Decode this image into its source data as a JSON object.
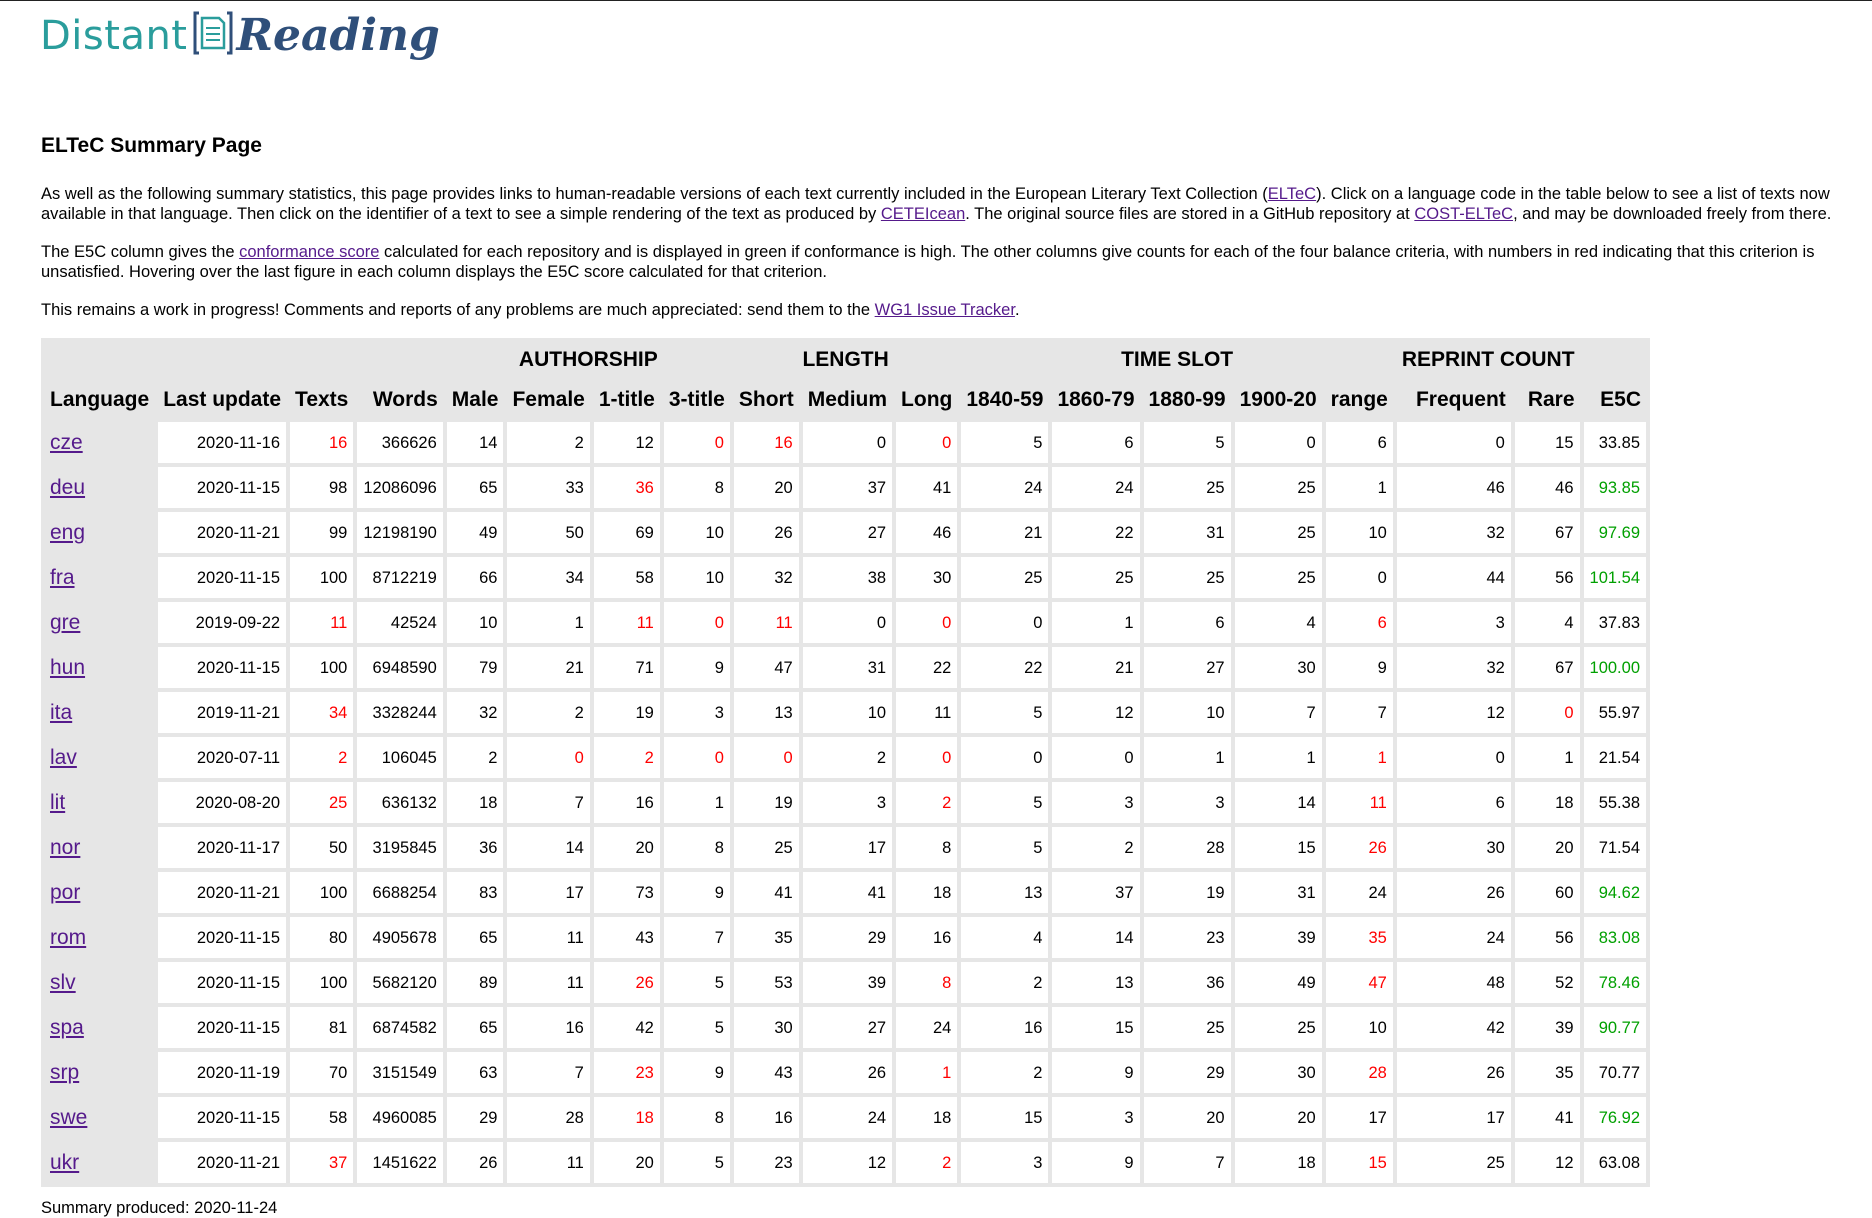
{
  "logo": {
    "word1": "Distant",
    "word2": "Reading"
  },
  "page_title": "ELTeC Summary Page",
  "intro": {
    "p1_a": "As well as the following summary statistics, this page provides links to human-readable versions of each text currently included in the European Literary Text Collection (",
    "p1_link1": "ELTeC",
    "p1_b": "). Click on a language code in the table below to see a list of texts now available in that language. Then click on the identifier of a text to see a simple rendering of the text as produced by ",
    "p1_link2": "CETEIcean",
    "p1_c": ". The original source files are stored in a GitHub repository at ",
    "p1_link3": "COST-ELTeC",
    "p1_d": ", and may be downloaded freely from there.",
    "p2_a": "The E5C column gives the ",
    "p2_link": "conformance score",
    "p2_b": " calculated for each repository and is displayed in green if conformance is high. The other columns give counts for each of the four balance criteria, with numbers in red indicating that this criterion is unsatisfied. Hovering over the last figure in each column displays the E5C score calculated for that criterion.",
    "p3_a": "This remains a work in progress! Comments and reports of any problems are much appreciated: send them to the ",
    "p3_link": "WG1 Issue Tracker",
    "p3_b": "."
  },
  "table": {
    "groups": [
      "AUTHORSHIP",
      "LENGTH",
      "TIME SLOT",
      "REPRINT COUNT"
    ],
    "headers": [
      "Language",
      "Last update",
      "Texts",
      "Words",
      "Male",
      "Female",
      "1-title",
      "3-title",
      "Short",
      "Medium",
      "Long",
      "1840-59",
      "1860-79",
      "1880-99",
      "1900-20",
      "range",
      "Frequent",
      "Rare",
      "E5C"
    ],
    "rows": [
      {
        "lang": "cze",
        "cells": [
          "2020-11-16",
          "16",
          "366626",
          "14",
          "2",
          "12",
          "0",
          "16",
          "0",
          "0",
          "5",
          "6",
          "5",
          "0",
          "6",
          "0",
          "15",
          "33.85"
        ],
        "red": [
          1,
          6,
          7,
          9
        ],
        "green": false
      },
      {
        "lang": "deu",
        "cells": [
          "2020-11-15",
          "98",
          "12086096",
          "65",
          "33",
          "36",
          "8",
          "20",
          "37",
          "41",
          "24",
          "24",
          "25",
          "25",
          "1",
          "46",
          "46",
          "93.85"
        ],
        "red": [
          5
        ],
        "green": true
      },
      {
        "lang": "eng",
        "cells": [
          "2020-11-21",
          "99",
          "12198190",
          "49",
          "50",
          "69",
          "10",
          "26",
          "27",
          "46",
          "21",
          "22",
          "31",
          "25",
          "10",
          "32",
          "67",
          "97.69"
        ],
        "red": [],
        "green": true
      },
      {
        "lang": "fra",
        "cells": [
          "2020-11-15",
          "100",
          "8712219",
          "66",
          "34",
          "58",
          "10",
          "32",
          "38",
          "30",
          "25",
          "25",
          "25",
          "25",
          "0",
          "44",
          "56",
          "101.54"
        ],
        "red": [],
        "green": true
      },
      {
        "lang": "gre",
        "cells": [
          "2019-09-22",
          "11",
          "42524",
          "10",
          "1",
          "11",
          "0",
          "11",
          "0",
          "0",
          "0",
          "1",
          "6",
          "4",
          "6",
          "3",
          "4",
          "37.83"
        ],
        "red": [
          1,
          5,
          6,
          7,
          9,
          14
        ],
        "green": false
      },
      {
        "lang": "hun",
        "cells": [
          "2020-11-15",
          "100",
          "6948590",
          "79",
          "21",
          "71",
          "9",
          "47",
          "31",
          "22",
          "22",
          "21",
          "27",
          "30",
          "9",
          "32",
          "67",
          "100.00"
        ],
        "red": [],
        "green": true
      },
      {
        "lang": "ita",
        "cells": [
          "2019-11-21",
          "34",
          "3328244",
          "32",
          "2",
          "19",
          "3",
          "13",
          "10",
          "11",
          "5",
          "12",
          "10",
          "7",
          "7",
          "12",
          "0",
          "55.97"
        ],
        "red": [
          1,
          16
        ],
        "green": false
      },
      {
        "lang": "lav",
        "cells": [
          "2020-07-11",
          "2",
          "106045",
          "2",
          "0",
          "2",
          "0",
          "0",
          "2",
          "0",
          "0",
          "0",
          "1",
          "1",
          "1",
          "0",
          "1",
          "21.54"
        ],
        "red": [
          1,
          4,
          5,
          6,
          7,
          9,
          14
        ],
        "green": false
      },
      {
        "lang": "lit",
        "cells": [
          "2020-08-20",
          "25",
          "636132",
          "18",
          "7",
          "16",
          "1",
          "19",
          "3",
          "2",
          "5",
          "3",
          "3",
          "14",
          "11",
          "6",
          "18",
          "55.38"
        ],
        "red": [
          1,
          9,
          14
        ],
        "green": false
      },
      {
        "lang": "nor",
        "cells": [
          "2020-11-17",
          "50",
          "3195845",
          "36",
          "14",
          "20",
          "8",
          "25",
          "17",
          "8",
          "5",
          "2",
          "28",
          "15",
          "26",
          "30",
          "20",
          "71.54"
        ],
        "red": [
          14
        ],
        "green": false
      },
      {
        "lang": "por",
        "cells": [
          "2020-11-21",
          "100",
          "6688254",
          "83",
          "17",
          "73",
          "9",
          "41",
          "41",
          "18",
          "13",
          "37",
          "19",
          "31",
          "24",
          "26",
          "60",
          "94.62"
        ],
        "red": [],
        "green": true
      },
      {
        "lang": "rom",
        "cells": [
          "2020-11-15",
          "80",
          "4905678",
          "65",
          "11",
          "43",
          "7",
          "35",
          "29",
          "16",
          "4",
          "14",
          "23",
          "39",
          "35",
          "24",
          "56",
          "83.08"
        ],
        "red": [
          14
        ],
        "green": true
      },
      {
        "lang": "slv",
        "cells": [
          "2020-11-15",
          "100",
          "5682120",
          "89",
          "11",
          "26",
          "5",
          "53",
          "39",
          "8",
          "2",
          "13",
          "36",
          "49",
          "47",
          "48",
          "52",
          "78.46"
        ],
        "red": [
          5,
          9,
          14
        ],
        "green": true
      },
      {
        "lang": "spa",
        "cells": [
          "2020-11-15",
          "81",
          "6874582",
          "65",
          "16",
          "42",
          "5",
          "30",
          "27",
          "24",
          "16",
          "15",
          "25",
          "25",
          "10",
          "42",
          "39",
          "90.77"
        ],
        "red": [],
        "green": true
      },
      {
        "lang": "srp",
        "cells": [
          "2020-11-19",
          "70",
          "3151549",
          "63",
          "7",
          "23",
          "9",
          "43",
          "26",
          "1",
          "2",
          "9",
          "29",
          "30",
          "28",
          "26",
          "35",
          "70.77"
        ],
        "red": [
          5,
          9,
          14
        ],
        "green": false
      },
      {
        "lang": "swe",
        "cells": [
          "2020-11-15",
          "58",
          "4960085",
          "29",
          "28",
          "18",
          "8",
          "16",
          "24",
          "18",
          "15",
          "3",
          "20",
          "20",
          "17",
          "17",
          "41",
          "76.92"
        ],
        "red": [
          5
        ],
        "green": true
      },
      {
        "lang": "ukr",
        "cells": [
          "2020-11-21",
          "37",
          "1451622",
          "26",
          "11",
          "20",
          "5",
          "23",
          "12",
          "2",
          "3",
          "9",
          "7",
          "18",
          "15",
          "25",
          "12",
          "63.08"
        ],
        "red": [
          1,
          9,
          14
        ],
        "green": false
      }
    ]
  },
  "footer": "Summary produced: 2020-11-24",
  "colors": {
    "red": "#ff0000",
    "green": "#00a000",
    "link": "#551a8b",
    "logo_teal": "#2a9d9c",
    "logo_navy": "#2f4f7a"
  }
}
